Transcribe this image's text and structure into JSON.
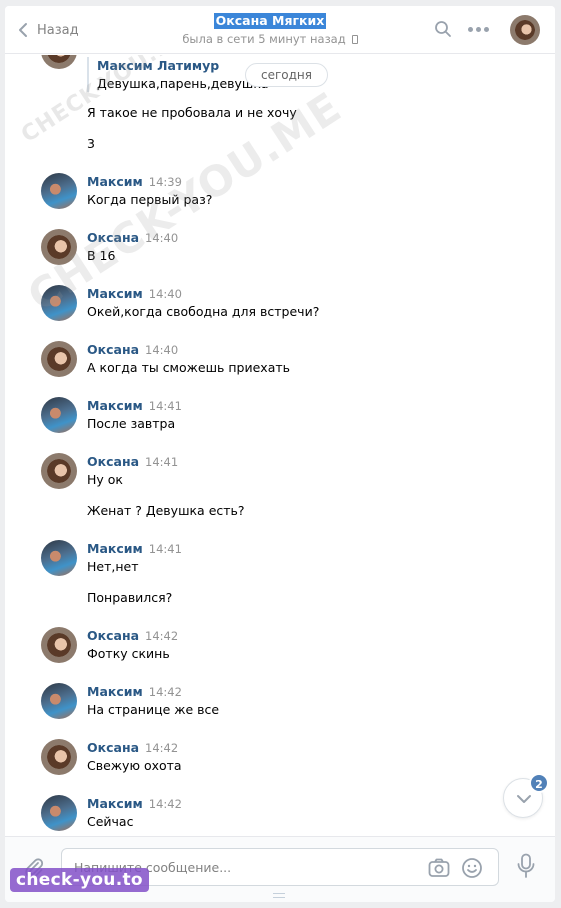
{
  "header": {
    "back_label": "Назад",
    "title": "Оксана Мягких",
    "status": "была в сети 5 минут назад"
  },
  "date_pill": "сегодня",
  "forwarded": {
    "author": "Максим Латимур",
    "text": "Девушка,парень,девушка"
  },
  "pre_lines": [
    "Я такое не пробовала и не хочу",
    "3"
  ],
  "messages": [
    {
      "author": "Максим",
      "time": "14:39",
      "lines": [
        "Когда первый раз?"
      ]
    },
    {
      "author": "Оксана",
      "time": "14:40",
      "lines": [
        "В 16"
      ]
    },
    {
      "author": "Максим",
      "time": "14:40",
      "lines": [
        "Окей,когда свободна для встречи?"
      ]
    },
    {
      "author": "Оксана",
      "time": "14:40",
      "lines": [
        "А когда ты сможешь приехать"
      ]
    },
    {
      "author": "Максим",
      "time": "14:41",
      "lines": [
        "После завтра"
      ]
    },
    {
      "author": "Оксана",
      "time": "14:41",
      "lines": [
        "Ну ок",
        "Женат ? Девушка есть?"
      ]
    },
    {
      "author": "Максим",
      "time": "14:41",
      "lines": [
        "Нет,нет",
        "Понравился?"
      ]
    },
    {
      "author": "Оксана",
      "time": "14:42",
      "lines": [
        "Фотку скинь"
      ]
    },
    {
      "author": "Максим",
      "time": "14:42",
      "lines": [
        "На странице же все"
      ]
    },
    {
      "author": "Оксана",
      "time": "14:42",
      "lines": [
        "Свежую охота"
      ]
    },
    {
      "author": "Максим",
      "time": "14:42",
      "lines": [
        "Сейчас"
      ]
    }
  ],
  "unread_count": "2",
  "composer": {
    "placeholder": "Напишите сообщение..."
  },
  "watermarks": [
    "CHECK-YOU.ME",
    "CHECK-YOU.ME"
  ],
  "bottom_watermark": "check-you.to",
  "icons": {
    "back": "chevron-left-icon",
    "search": "search-icon",
    "more": "more-dots-icon",
    "attach": "paperclip-icon",
    "camera": "camera-icon",
    "emoji": "emoji-icon",
    "mic": "microphone-icon",
    "scroll": "chevron-down-icon"
  },
  "colors": {
    "link": "#2a5885",
    "title_highlight": "#3b86d9",
    "badge": "#5181b8",
    "time": "#939393"
  }
}
